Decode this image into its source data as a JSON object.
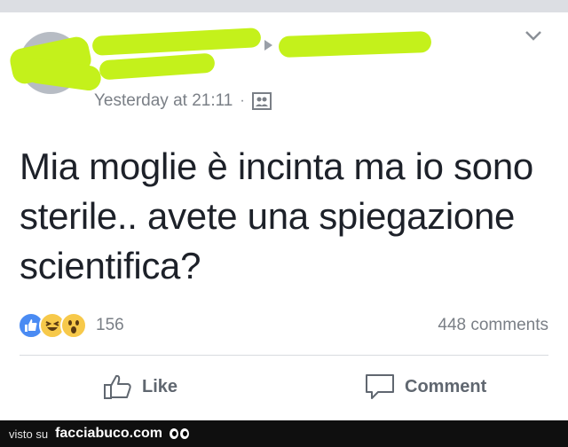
{
  "post": {
    "timestamp": "Yesterday at 21:11",
    "separator": "·",
    "audience_icon": "friends-icon",
    "text_line1": "Mia moglie è incinta ma io sono",
    "text_line2": "sterile.. avete una spiegazione",
    "text_line3": "scientifica?"
  },
  "reactions": {
    "icons": [
      "like-reaction-icon",
      "haha-reaction-icon",
      "wow-reaction-icon"
    ],
    "count": "156"
  },
  "comments": {
    "count_label": "448 comments"
  },
  "actions": {
    "like_label": "Like",
    "comment_label": "Comment"
  },
  "footer": {
    "visto_label": "visto su",
    "site_label": "facciabuco.com"
  },
  "colors": {
    "scribble": "#c4f11b",
    "like_blue": "#4a8bf3",
    "emoji_yellow": "#f7c94a",
    "meta_gray": "#7a7f86"
  }
}
